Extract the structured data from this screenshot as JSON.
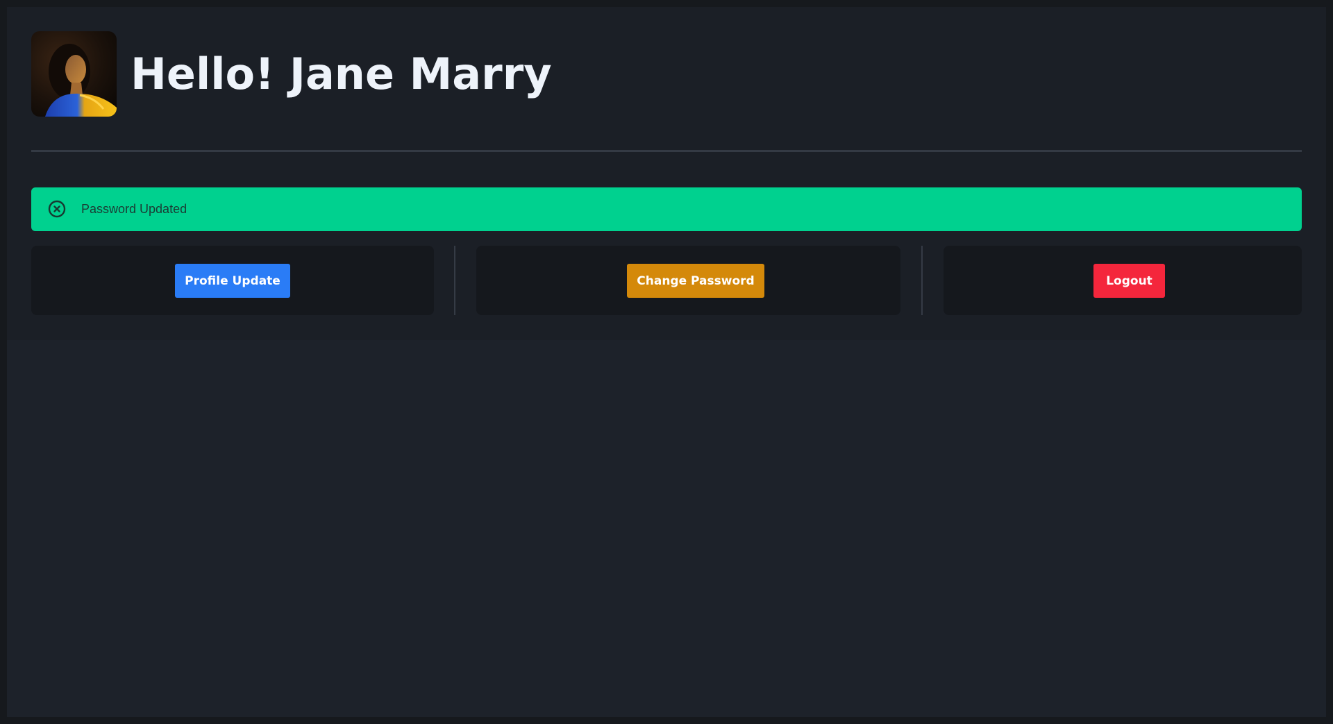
{
  "header": {
    "greeting": "Hello! Jane Marry",
    "avatar_icon": "user-portrait"
  },
  "alert": {
    "message": "Password Updated",
    "icon": "close-circle-icon",
    "color": "#00d18f"
  },
  "actions": {
    "profile_update_label": "Profile Update",
    "change_password_label": "Change Password",
    "logout_label": "Logout"
  },
  "colors": {
    "primary": "#2a7cf6",
    "warning": "#d4890a",
    "danger": "#f4263c",
    "success": "#00d18f",
    "background": "#1d222a"
  }
}
